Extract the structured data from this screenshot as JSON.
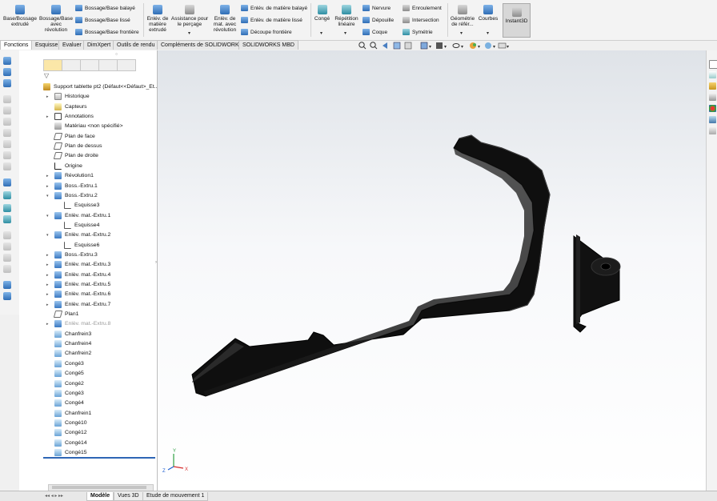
{
  "ribbon": {
    "big": [
      {
        "id": "extrude",
        "label": "Base/Bossage extrudé"
      },
      {
        "id": "revolve",
        "label": "Bossage/Base avec révolution"
      },
      {
        "id": "cut_extrude",
        "label": "Enlév. de matière extrudé"
      },
      {
        "id": "hole_wizard",
        "label": "Assistance pour le perçage"
      },
      {
        "id": "cut_revolve",
        "label": "Enlèv. de mat. avec révolution"
      },
      {
        "id": "fillet",
        "label": "Congé"
      },
      {
        "id": "linear_pattern",
        "label": "Répétition linéaire"
      },
      {
        "id": "ref_geometry",
        "label": "Géométrie de référ..."
      },
      {
        "id": "curves",
        "label": "Courbes"
      },
      {
        "id": "instant3d",
        "label": "Instant3D"
      }
    ],
    "small": [
      {
        "id": "swept_boss",
        "label": "Bossage/Base balayé"
      },
      {
        "id": "lofted_boss",
        "label": "Bossage/Base lissé"
      },
      {
        "id": "boundary_boss",
        "label": "Bossage/Base frontière"
      },
      {
        "id": "swept_cut",
        "label": "Enlév. de matière balayé"
      },
      {
        "id": "lofted_cut",
        "label": "Enlèv. de matière lissé"
      },
      {
        "id": "boundary_cut",
        "label": "Découpe frontière"
      },
      {
        "id": "rib",
        "label": "Nervure"
      },
      {
        "id": "draft",
        "label": "Dépouille"
      },
      {
        "id": "shell",
        "label": "Coque"
      },
      {
        "id": "wrap",
        "label": "Enroulement"
      },
      {
        "id": "intersect",
        "label": "Intersection"
      },
      {
        "id": "mirror",
        "label": "Symétrie"
      }
    ]
  },
  "tabs": [
    "Fonctions",
    "Esquisse",
    "Evaluer",
    "DimXpert",
    "Outils de rendu",
    "Compléments de SOLIDWORKS",
    "SOLIDWORKS MBD"
  ],
  "tree": [
    {
      "label": "Support tablette pt2  (Défaut<<Défaut>_Et...",
      "icon": "part",
      "level": 0,
      "arrow": false,
      "dim": false
    },
    {
      "label": "Historique",
      "icon": "folder",
      "level": 1,
      "arrow": true,
      "dim": false
    },
    {
      "label": "Capteurs",
      "icon": "sensor",
      "level": 1,
      "arrow": false,
      "dim": false
    },
    {
      "label": "Annotations",
      "icon": "annot",
      "level": 1,
      "arrow": true,
      "dim": false
    },
    {
      "label": "Matériau <non spécifié>",
      "icon": "mat",
      "level": 1,
      "arrow": false,
      "dim": false
    },
    {
      "label": "Plan de face",
      "icon": "plane",
      "level": 1,
      "arrow": false,
      "dim": false
    },
    {
      "label": "Plan de dessus",
      "icon": "plane",
      "level": 1,
      "arrow": false,
      "dim": false
    },
    {
      "label": "Plan de droite",
      "icon": "plane",
      "level": 1,
      "arrow": false,
      "dim": false
    },
    {
      "label": "Origine",
      "icon": "origin",
      "level": 1,
      "arrow": false,
      "dim": false
    },
    {
      "label": "Révolution1",
      "icon": "feat",
      "level": 1,
      "arrow": true,
      "dim": false
    },
    {
      "label": "Boss.-Extru.1",
      "icon": "feat",
      "level": 1,
      "arrow": true,
      "dim": false
    },
    {
      "label": "Boss.-Extru.2",
      "icon": "feat",
      "level": 1,
      "arrow": "open",
      "dim": false
    },
    {
      "label": "Esquisse3",
      "icon": "sketch",
      "level": 2,
      "arrow": false,
      "dim": false
    },
    {
      "label": "Enlèv. mat.-Extru.1",
      "icon": "feat",
      "level": 1,
      "arrow": "open",
      "dim": false
    },
    {
      "label": "Esquisse4",
      "icon": "sketch",
      "level": 2,
      "arrow": false,
      "dim": false
    },
    {
      "label": "Enlèv. mat.-Extru.2",
      "icon": "feat",
      "level": 1,
      "arrow": "open",
      "dim": false
    },
    {
      "label": "Esquisse6",
      "icon": "sketch",
      "level": 2,
      "arrow": false,
      "dim": false
    },
    {
      "label": "Boss.-Extru.3",
      "icon": "feat",
      "level": 1,
      "arrow": true,
      "dim": false
    },
    {
      "label": "Enlèv. mat.-Extru.3",
      "icon": "feat",
      "level": 1,
      "arrow": true,
      "dim": false
    },
    {
      "label": "Enlèv. mat.-Extru.4",
      "icon": "feat",
      "level": 1,
      "arrow": true,
      "dim": false
    },
    {
      "label": "Enlèv. mat.-Extru.5",
      "icon": "feat",
      "level": 1,
      "arrow": true,
      "dim": false
    },
    {
      "label": "Enlèv. mat.-Extru.6",
      "icon": "feat",
      "level": 1,
      "arrow": true,
      "dim": false
    },
    {
      "label": "Enlèv. mat.-Extru.7",
      "icon": "feat",
      "level": 1,
      "arrow": true,
      "dim": false
    },
    {
      "label": "Plan1",
      "icon": "plane",
      "level": 1,
      "arrow": false,
      "dim": false
    },
    {
      "label": "Enlèv. mat.-Extru.8",
      "icon": "feat",
      "level": 1,
      "arrow": true,
      "dim": true
    },
    {
      "label": "Chanfrein3",
      "icon": "fillet",
      "level": 1,
      "arrow": false,
      "dim": false
    },
    {
      "label": "Chanfrein4",
      "icon": "fillet",
      "level": 1,
      "arrow": false,
      "dim": false
    },
    {
      "label": "Chanfrein2",
      "icon": "fillet",
      "level": 1,
      "arrow": false,
      "dim": false
    },
    {
      "label": "Congé3",
      "icon": "fillet",
      "level": 1,
      "arrow": false,
      "dim": false
    },
    {
      "label": "Congé5",
      "icon": "fillet",
      "level": 1,
      "arrow": false,
      "dim": false
    },
    {
      "label": "Congé2",
      "icon": "fillet",
      "level": 1,
      "arrow": false,
      "dim": false
    },
    {
      "label": "Congé3",
      "icon": "fillet",
      "level": 1,
      "arrow": false,
      "dim": false
    },
    {
      "label": "Congé4",
      "icon": "fillet",
      "level": 1,
      "arrow": false,
      "dim": false
    },
    {
      "label": "Chanfrein1",
      "icon": "fillet",
      "level": 1,
      "arrow": false,
      "dim": false
    },
    {
      "label": "Congé10",
      "icon": "fillet",
      "level": 1,
      "arrow": false,
      "dim": false
    },
    {
      "label": "Congé12",
      "icon": "fillet",
      "level": 1,
      "arrow": false,
      "dim": false
    },
    {
      "label": "Congé14",
      "icon": "fillet",
      "level": 1,
      "arrow": false,
      "dim": false
    },
    {
      "label": "Congé15",
      "icon": "fillet",
      "level": 1,
      "arrow": false,
      "dim": false
    }
  ],
  "bottom_tabs": [
    "Modèle",
    "Vues 3D",
    "Etude de mouvement 1"
  ],
  "triad": {
    "x": "X",
    "y": "Y",
    "z": "Z"
  }
}
